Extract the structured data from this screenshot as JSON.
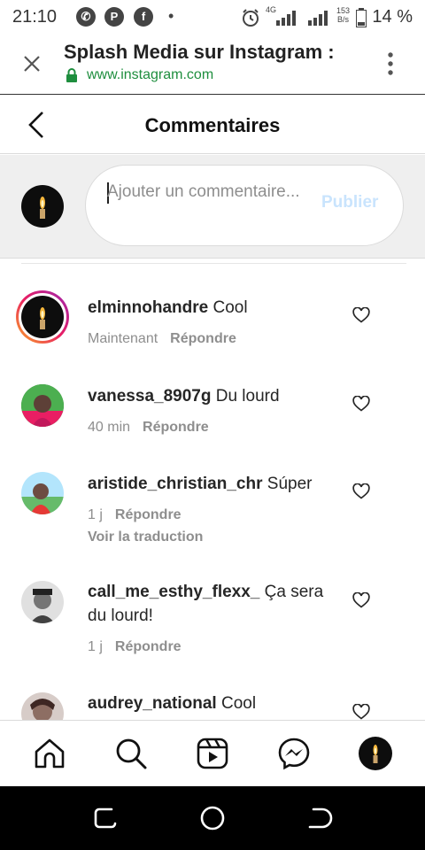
{
  "status_bar": {
    "time": "21:10",
    "icons": [
      "whatsapp-icon",
      "app-icon",
      "facebook-icon"
    ],
    "dot": "•",
    "network_label": "4G",
    "speed_value": "153",
    "speed_unit": "B/s",
    "battery": "14 %"
  },
  "browser": {
    "title": "Splash Media sur Instagram :",
    "url": "www.instagram.com"
  },
  "header": {
    "title": "Commentaires"
  },
  "composer": {
    "placeholder": "Ajouter un commentaire...",
    "publish_label": "Publier"
  },
  "comments": [
    {
      "username": "elminnohandre",
      "text": "Cool",
      "time": "Maintenant",
      "reply_label": "Répondre"
    },
    {
      "username": "vanessa_8907g",
      "text": "Du lourd",
      "time": "40 min",
      "reply_label": "Répondre"
    },
    {
      "username": "aristide_christian_chr",
      "text": "Súper",
      "time": "1 j",
      "reply_label": "Répondre",
      "translate_label": "Voir la traduction"
    },
    {
      "username": "call_me_esthy_flexx_",
      "text": "Ça sera du lourd!",
      "time": "1 j",
      "reply_label": "Répondre"
    },
    {
      "username": "audrey_national",
      "text": "Cool"
    }
  ],
  "bottom_nav": [
    "home-icon",
    "search-icon",
    "reels-icon",
    "messenger-icon",
    "profile-avatar"
  ],
  "colors": {
    "publish_disabled": "#c9e4fd",
    "secure_green": "#1e8e3e",
    "story_ring": [
      "#f9a825",
      "#e91e63",
      "#9c27b0"
    ]
  }
}
